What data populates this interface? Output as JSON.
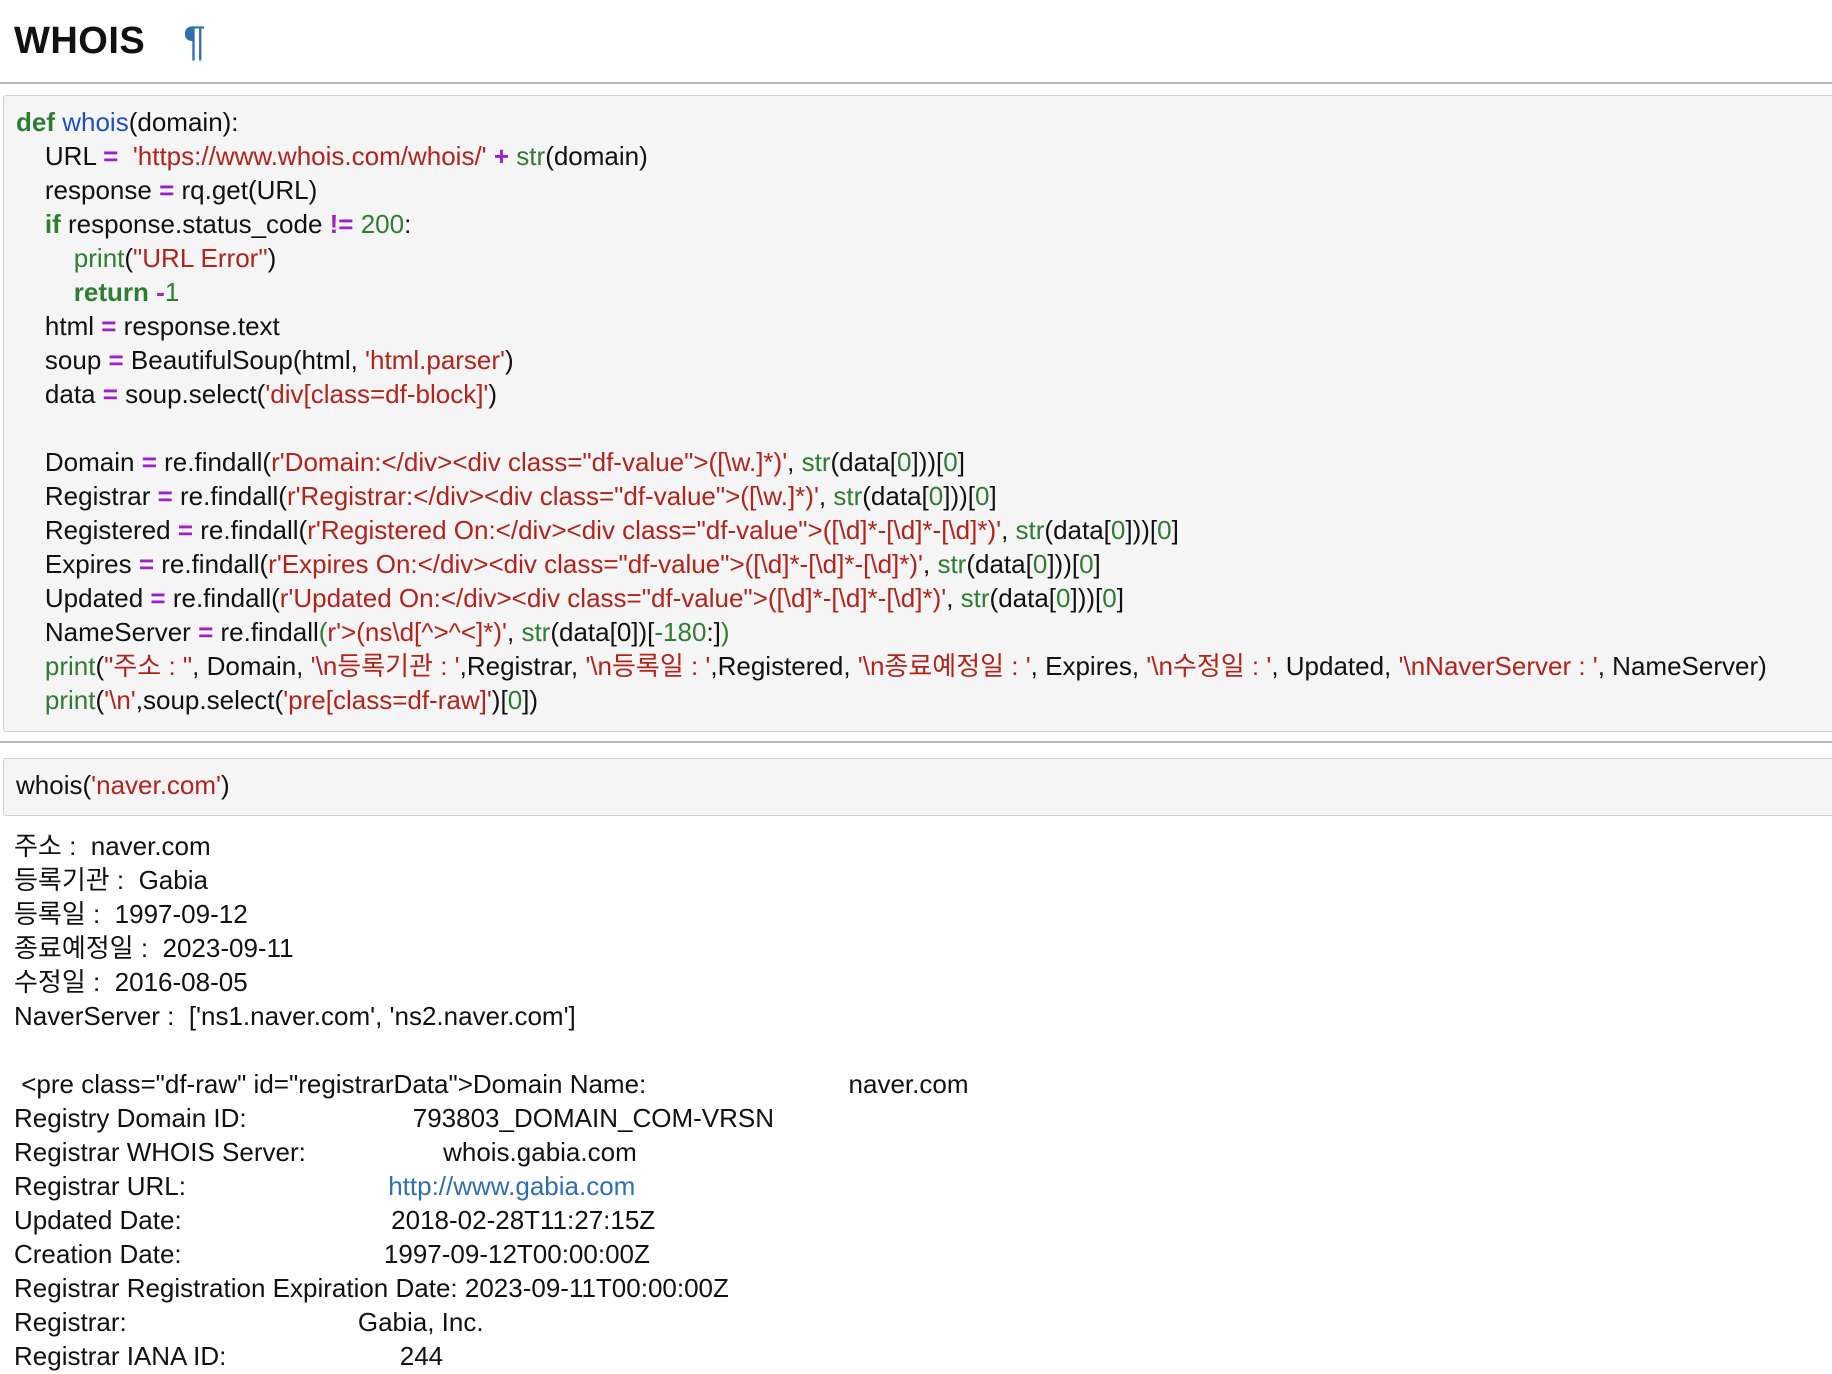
{
  "heading": {
    "title": "WHOIS",
    "anchor": "¶"
  },
  "colors": {
    "keyword": "#2e7d32",
    "function_name": "#1f4fc4",
    "string": "#b3231c",
    "operator": "#a020c8",
    "number": "#2e7d32",
    "link": "#2f6fb0",
    "cell_background": "#f5f5f5"
  },
  "code_cell": {
    "lines": [
      [
        {
          "t": "def",
          "c": "kw"
        },
        {
          "t": " "
        },
        {
          "t": "whois",
          "c": "fn"
        },
        {
          "t": "(domain):"
        }
      ],
      [
        {
          "t": "    URL "
        },
        {
          "t": "=",
          "c": "op"
        },
        {
          "t": "  "
        },
        {
          "t": "'https://www.whois.com/whois/'",
          "c": "st"
        },
        {
          "t": " "
        },
        {
          "t": "+",
          "c": "op"
        },
        {
          "t": " "
        },
        {
          "t": "str",
          "c": "bi"
        },
        {
          "t": "(domain)"
        }
      ],
      [
        {
          "t": "    response "
        },
        {
          "t": "=",
          "c": "op"
        },
        {
          "t": " rq.get(URL)"
        }
      ],
      [
        {
          "t": "    "
        },
        {
          "t": "if",
          "c": "kw"
        },
        {
          "t": " response.status_code "
        },
        {
          "t": "!=",
          "c": "op"
        },
        {
          "t": " "
        },
        {
          "t": "200",
          "c": "num"
        },
        {
          "t": ":"
        }
      ],
      [
        {
          "t": "        "
        },
        {
          "t": "print",
          "c": "bi"
        },
        {
          "t": "("
        },
        {
          "t": "\"URL Error\"",
          "c": "st"
        },
        {
          "t": ")"
        }
      ],
      [
        {
          "t": "        "
        },
        {
          "t": "return",
          "c": "kw"
        },
        {
          "t": " "
        },
        {
          "t": "-",
          "c": "op"
        },
        {
          "t": "1",
          "c": "num"
        }
      ],
      [
        {
          "t": "    html "
        },
        {
          "t": "=",
          "c": "op"
        },
        {
          "t": " response.text"
        }
      ],
      [
        {
          "t": "    soup "
        },
        {
          "t": "=",
          "c": "op"
        },
        {
          "t": " BeautifulSoup(html, "
        },
        {
          "t": "'html.parser'",
          "c": "st"
        },
        {
          "t": ")"
        }
      ],
      [
        {
          "t": "    data "
        },
        {
          "t": "=",
          "c": "op"
        },
        {
          "t": " soup.select("
        },
        {
          "t": "'div[class=df-block]'",
          "c": "st"
        },
        {
          "t": ")"
        }
      ],
      [
        {
          "t": ""
        }
      ],
      [
        {
          "t": "    Domain "
        },
        {
          "t": "=",
          "c": "op"
        },
        {
          "t": " re.findall("
        },
        {
          "t": "r'Domain:</div><div class=\"df-value\">([\\w.]*)'",
          "c": "st"
        },
        {
          "t": ", "
        },
        {
          "t": "str",
          "c": "bi"
        },
        {
          "t": "(data["
        },
        {
          "t": "0",
          "c": "num"
        },
        {
          "t": "]))["
        },
        {
          "t": "0",
          "c": "num"
        },
        {
          "t": "]"
        }
      ],
      [
        {
          "t": "    Registrar "
        },
        {
          "t": "=",
          "c": "op"
        },
        {
          "t": " re.findall("
        },
        {
          "t": "r'Registrar:</div><div class=\"df-value\">([\\w.]*)'",
          "c": "st"
        },
        {
          "t": ", "
        },
        {
          "t": "str",
          "c": "bi"
        },
        {
          "t": "(data["
        },
        {
          "t": "0",
          "c": "num"
        },
        {
          "t": "]))["
        },
        {
          "t": "0",
          "c": "num"
        },
        {
          "t": "]"
        }
      ],
      [
        {
          "t": "    Registered "
        },
        {
          "t": "=",
          "c": "op"
        },
        {
          "t": " re.findall("
        },
        {
          "t": "r'Registered On:</div><div class=\"df-value\">([\\d]*-[\\d]*-[\\d]*)'",
          "c": "st"
        },
        {
          "t": ", "
        },
        {
          "t": "str",
          "c": "bi"
        },
        {
          "t": "(data["
        },
        {
          "t": "0",
          "c": "num"
        },
        {
          "t": "]))["
        },
        {
          "t": "0",
          "c": "num"
        },
        {
          "t": "]"
        }
      ],
      [
        {
          "t": "    Expires "
        },
        {
          "t": "=",
          "c": "op"
        },
        {
          "t": " re.findall("
        },
        {
          "t": "r'Expires On:</div><div class=\"df-value\">([\\d]*-[\\d]*-[\\d]*)'",
          "c": "st"
        },
        {
          "t": ", "
        },
        {
          "t": "str",
          "c": "bi"
        },
        {
          "t": "(data["
        },
        {
          "t": "0",
          "c": "num"
        },
        {
          "t": "]))["
        },
        {
          "t": "0",
          "c": "num"
        },
        {
          "t": "]"
        }
      ],
      [
        {
          "t": "    Updated "
        },
        {
          "t": "=",
          "c": "op"
        },
        {
          "t": " re.findall("
        },
        {
          "t": "r'Updated On:</div><div class=\"df-value\">([\\d]*-[\\d]*-[\\d]*)'",
          "c": "st"
        },
        {
          "t": ", "
        },
        {
          "t": "str",
          "c": "bi"
        },
        {
          "t": "(data["
        },
        {
          "t": "0",
          "c": "num"
        },
        {
          "t": "]))["
        },
        {
          "t": "0",
          "c": "num"
        },
        {
          "t": "]"
        }
      ],
      [
        {
          "t": "    NameServer "
        },
        {
          "t": "=",
          "c": "op"
        },
        {
          "t": " re.findall"
        },
        {
          "t": "(",
          "c": "bi"
        },
        {
          "t": "r'>(ns\\d[^>^<]*)'",
          "c": "st"
        },
        {
          "t": ", "
        },
        {
          "t": "str",
          "c": "bi"
        },
        {
          "t": "(data[0])["
        },
        {
          "t": "-180",
          "c": "num"
        },
        {
          "t": ":]"
        },
        {
          "t": ")",
          "c": "bi"
        }
      ],
      [
        {
          "t": "    "
        },
        {
          "t": "print",
          "c": "bi"
        },
        {
          "t": "("
        },
        {
          "t": "\"주소 : \"",
          "c": "st"
        },
        {
          "t": ", Domain, "
        },
        {
          "t": "'\\n등록기관 : '",
          "c": "st"
        },
        {
          "t": ",Registrar, "
        },
        {
          "t": "'\\n등록일 : '",
          "c": "st"
        },
        {
          "t": ",Registered, "
        },
        {
          "t": "'\\n종료예정일 : '",
          "c": "st"
        },
        {
          "t": ", Expires, "
        },
        {
          "t": "'\\n수정일 : '",
          "c": "st"
        },
        {
          "t": ", Updated, "
        },
        {
          "t": "'\\nNaverServer : '",
          "c": "st"
        },
        {
          "t": ", NameServer)"
        }
      ],
      [
        {
          "t": "    "
        },
        {
          "t": "print",
          "c": "bi"
        },
        {
          "t": "("
        },
        {
          "t": "'\\n'",
          "c": "st"
        },
        {
          "t": ",soup.select("
        },
        {
          "t": "'pre[class=df-raw]'",
          "c": "st"
        },
        {
          "t": ")["
        },
        {
          "t": "0",
          "c": "num"
        },
        {
          "t": "])"
        }
      ]
    ]
  },
  "call_cell": {
    "lines": [
      [
        {
          "t": "whois("
        },
        {
          "t": "'naver.com'",
          "c": "st"
        },
        {
          "t": ")"
        }
      ]
    ]
  },
  "output": {
    "lines": [
      [
        {
          "t": "주소 :  naver.com"
        }
      ],
      [
        {
          "t": "등록기관 :  Gabia"
        }
      ],
      [
        {
          "t": "등록일 :  1997-09-12"
        }
      ],
      [
        {
          "t": "종료예정일 :  2023-09-11"
        }
      ],
      [
        {
          "t": "수정일 :  2016-08-05"
        }
      ],
      [
        {
          "t": "NaverServer :  ['ns1.naver.com', 'ns2.naver.com']"
        }
      ],
      [
        {
          "t": ""
        }
      ],
      [
        {
          "t": " <pre class=\"df-raw\" id=\"registrarData\">Domain Name:                            naver.com"
        }
      ],
      [
        {
          "t": "Registry Domain ID:                       793803_DOMAIN_COM-VRSN"
        }
      ],
      [
        {
          "t": "Registrar WHOIS Server:                   whois.gabia.com"
        }
      ],
      [
        {
          "t": "Registrar URL:                            "
        },
        {
          "t": "http://www.gabia.com",
          "c": "link"
        }
      ],
      [
        {
          "t": "Updated Date:                             2018-02-28T11:27:15Z"
        }
      ],
      [
        {
          "t": "Creation Date:                            1997-09-12T00:00:00Z"
        }
      ],
      [
        {
          "t": "Registrar Registration Expiration Date: 2023-09-11T00:00:00Z"
        }
      ],
      [
        {
          "t": "Registrar:                                Gabia, Inc."
        }
      ],
      [
        {
          "t": "Registrar IANA ID:                        244"
        }
      ]
    ]
  }
}
